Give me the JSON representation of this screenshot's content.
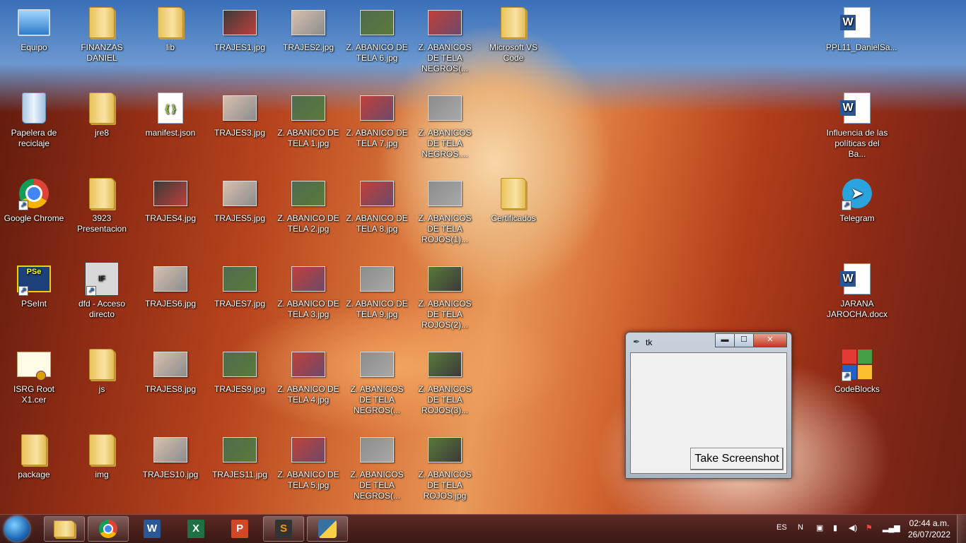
{
  "desktop": {
    "icons": [
      {
        "label": "Equipo",
        "kind": "computer",
        "shortcut": false
      },
      {
        "label": "FINANZAS DANIEL",
        "kind": "folder",
        "shortcut": false
      },
      {
        "label": "lib",
        "kind": "folder",
        "shortcut": false
      },
      {
        "label": "TRAJES1.jpg",
        "kind": "photo",
        "shortcut": false
      },
      {
        "label": "TRAJES2.jpg",
        "kind": "photo",
        "shortcut": false
      },
      {
        "label": "Z. ABANICO DE TELA 6.jpg",
        "kind": "photo",
        "shortcut": false
      },
      {
        "label": "Z. ABANICOS DE TELA NEGROS(...",
        "kind": "photo",
        "shortcut": false
      },
      {
        "label": "Microsoft VS Code",
        "kind": "folder",
        "shortcut": false
      },
      {
        "label": "PPL11_DanielSa...",
        "kind": "word",
        "shortcut": false
      },
      {
        "label": "Papelera de reciclaje",
        "kind": "recycle",
        "shortcut": false
      },
      {
        "label": "jre8",
        "kind": "folder",
        "shortcut": false
      },
      {
        "label": "manifest.json",
        "kind": "json",
        "shortcut": false
      },
      {
        "label": "TRAJES3.jpg",
        "kind": "photo",
        "shortcut": false
      },
      {
        "label": "Z. ABANICO DE TELA 1.jpg",
        "kind": "photo",
        "shortcut": false
      },
      {
        "label": "Z. ABANICO DE TELA 7.jpg",
        "kind": "photo",
        "shortcut": false
      },
      {
        "label": "Z. ABANICOS DE TELA NEGROS....",
        "kind": "photo",
        "shortcut": false
      },
      {
        "label": "Influencia de las políticas del Ba...",
        "kind": "word",
        "shortcut": false
      },
      {
        "label": "Google Chrome",
        "kind": "chrome",
        "shortcut": true
      },
      {
        "label": "3923 Presentacion",
        "kind": "folder",
        "shortcut": false
      },
      {
        "label": "TRAJES4.jpg",
        "kind": "photo",
        "shortcut": false
      },
      {
        "label": "TRAJES5.jpg",
        "kind": "photo",
        "shortcut": false
      },
      {
        "label": "Z. ABANICO DE TELA 2.jpg",
        "kind": "photo",
        "shortcut": false
      },
      {
        "label": "Z. ABANICO DE TELA 8.jpg",
        "kind": "photo",
        "shortcut": false
      },
      {
        "label": "Z. ABANICOS DE TELA ROJOS(1)...",
        "kind": "photo",
        "shortcut": false
      },
      {
        "label": "Certificados",
        "kind": "folder",
        "shortcut": false
      },
      {
        "label": "Telegram",
        "kind": "telegram",
        "shortcut": true
      },
      {
        "label": "PSeInt",
        "kind": "pseint",
        "shortcut": true
      },
      {
        "label": "dfd - Acceso directo",
        "kind": "dfd",
        "shortcut": true
      },
      {
        "label": "TRAJES6.jpg",
        "kind": "photo",
        "shortcut": false
      },
      {
        "label": "TRAJES7.jpg",
        "kind": "photo",
        "shortcut": false
      },
      {
        "label": "Z. ABANICO DE TELA 3.jpg",
        "kind": "photo",
        "shortcut": false
      },
      {
        "label": "Z. ABANICO DE TELA 9.jpg",
        "kind": "photo",
        "shortcut": false
      },
      {
        "label": "Z. ABANICOS DE TELA ROJOS(2)...",
        "kind": "photo",
        "shortcut": false
      },
      {
        "label": "JARANA JAROCHA.docx",
        "kind": "word",
        "shortcut": false
      },
      {
        "label": "ISRG Root X1.cer",
        "kind": "cert",
        "shortcut": false
      },
      {
        "label": "js",
        "kind": "folder",
        "shortcut": false
      },
      {
        "label": "TRAJES8.jpg",
        "kind": "photo",
        "shortcut": false
      },
      {
        "label": "TRAJES9.jpg",
        "kind": "photo",
        "shortcut": false
      },
      {
        "label": "Z. ABANICO DE TELA 4.jpg",
        "kind": "photo",
        "shortcut": false
      },
      {
        "label": "Z. ABANICOS DE TELA NEGROS(...",
        "kind": "photo",
        "shortcut": false
      },
      {
        "label": "Z. ABANICOS DE TELA ROJOS(3)...",
        "kind": "photo",
        "shortcut": false
      },
      {
        "label": "CodeBlocks",
        "kind": "codeblocks",
        "shortcut": true
      },
      {
        "label": "package",
        "kind": "folder",
        "shortcut": false
      },
      {
        "label": "img",
        "kind": "folder",
        "shortcut": false
      },
      {
        "label": "TRAJES10.jpg",
        "kind": "photo",
        "shortcut": false
      },
      {
        "label": "TRAJES11.jpg",
        "kind": "photo",
        "shortcut": false
      },
      {
        "label": "Z. ABANICO DE TELA 5.jpg",
        "kind": "photo",
        "shortcut": false
      },
      {
        "label": "Z. ABANICOS DE TELA NEGROS(...",
        "kind": "photo",
        "shortcut": false
      },
      {
        "label": "Z. ABANICOS DE TELA ROJOS.jpg",
        "kind": "photo",
        "shortcut": false
      }
    ]
  },
  "tk_window": {
    "title": "tk",
    "minimize_glyph": "▬",
    "maximize_glyph": "☐",
    "close_glyph": "✕",
    "screenshot_button": "Take Screenshot"
  },
  "taskbar": {
    "pinned": [
      {
        "name": "explorer",
        "icon": "folder-icon"
      },
      {
        "name": "chrome",
        "icon": "chrome-icon"
      },
      {
        "name": "word",
        "icon": "word-icon",
        "letter": "W"
      },
      {
        "name": "excel",
        "icon": "excel-icon",
        "letter": "X"
      },
      {
        "name": "powerpoint",
        "icon": "powerpoint-icon",
        "letter": "P"
      },
      {
        "name": "sublime",
        "icon": "sublime-icon",
        "letter": "S"
      },
      {
        "name": "python",
        "icon": "python-icon"
      }
    ],
    "language": "ES",
    "time": "02:44 a.m.",
    "date": "26/07/2022"
  },
  "colors": {
    "accent": "#2b5797",
    "excel": "#1e7145",
    "powerpoint": "#d24726",
    "sublime": "#ff9800"
  }
}
